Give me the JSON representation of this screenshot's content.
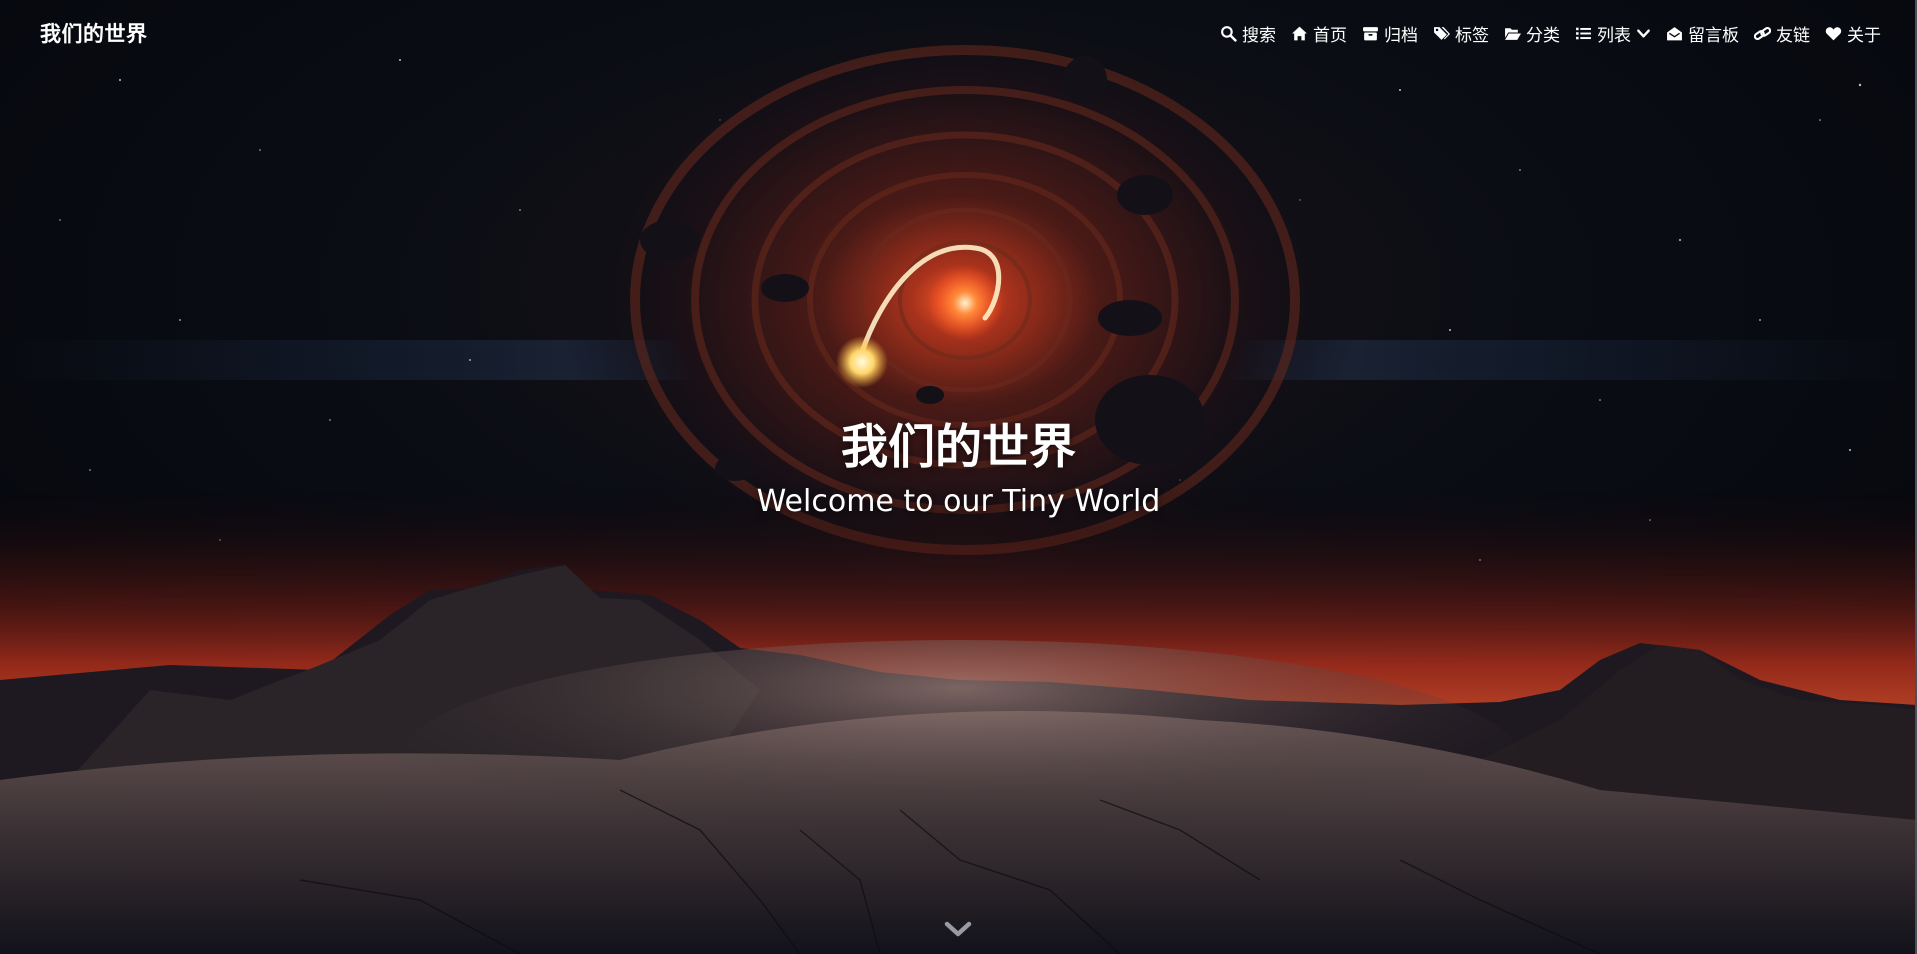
{
  "site": {
    "name": "我们的世界"
  },
  "nav": {
    "items": [
      {
        "label": "搜索",
        "icon": "search-icon"
      },
      {
        "label": "首页",
        "icon": "home-icon"
      },
      {
        "label": "归档",
        "icon": "archive-icon"
      },
      {
        "label": "标签",
        "icon": "tags-icon"
      },
      {
        "label": "分类",
        "icon": "folder-open-icon"
      },
      {
        "label": "列表",
        "icon": "list-icon",
        "dropdown": true
      },
      {
        "label": "留言板",
        "icon": "envelope-open-icon"
      },
      {
        "label": "友链",
        "icon": "link-icon"
      },
      {
        "label": "关于",
        "icon": "heart-icon"
      }
    ]
  },
  "hero": {
    "title": "我们的世界",
    "subtitle": "Welcome to our Tiny World"
  },
  "scroll": {
    "icon": "chevron-down-icon"
  },
  "colors": {
    "text": "#ffffff",
    "sky": "#05070d",
    "horizon_glow": "#b0301c",
    "ground": "#5a4a48"
  }
}
